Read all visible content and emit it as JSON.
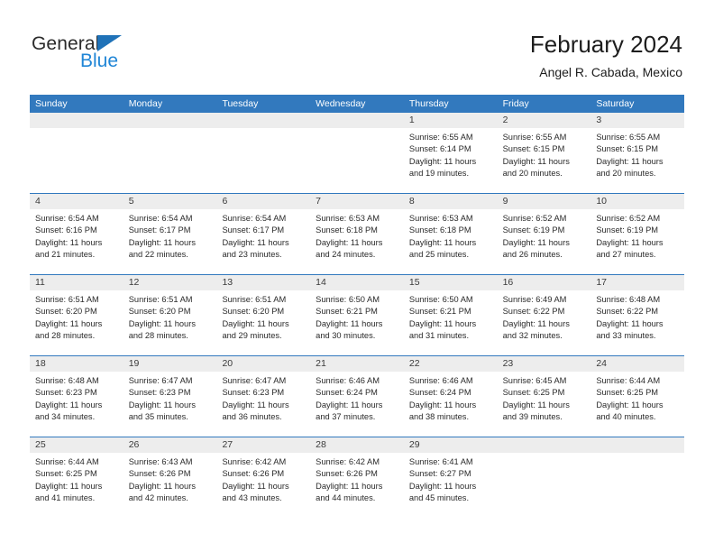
{
  "brand": {
    "name_part1": "General",
    "name_part2": "Blue",
    "triangle_icon": "blue-triangle-icon",
    "color_dark": "#2b2b2b",
    "color_blue": "#1f85d6"
  },
  "header": {
    "title": "February 2024",
    "subtitle": "Angel R. Cabada, Mexico"
  },
  "theme": {
    "header_blue": "#3279be",
    "daynum_gray": "#ededed",
    "text": "#2a2a2a"
  },
  "weekdays": [
    "Sunday",
    "Monday",
    "Tuesday",
    "Wednesday",
    "Thursday",
    "Friday",
    "Saturday"
  ],
  "weeks": [
    {
      "days": [
        {
          "num": "",
          "lines": []
        },
        {
          "num": "",
          "lines": []
        },
        {
          "num": "",
          "lines": []
        },
        {
          "num": "",
          "lines": []
        },
        {
          "num": "1",
          "lines": [
            "Sunrise: 6:55 AM",
            "Sunset: 6:14 PM",
            "Daylight: 11 hours",
            "and 19 minutes."
          ]
        },
        {
          "num": "2",
          "lines": [
            "Sunrise: 6:55 AM",
            "Sunset: 6:15 PM",
            "Daylight: 11 hours",
            "and 20 minutes."
          ]
        },
        {
          "num": "3",
          "lines": [
            "Sunrise: 6:55 AM",
            "Sunset: 6:15 PM",
            "Daylight: 11 hours",
            "and 20 minutes."
          ]
        }
      ]
    },
    {
      "days": [
        {
          "num": "4",
          "lines": [
            "Sunrise: 6:54 AM",
            "Sunset: 6:16 PM",
            "Daylight: 11 hours",
            "and 21 minutes."
          ]
        },
        {
          "num": "5",
          "lines": [
            "Sunrise: 6:54 AM",
            "Sunset: 6:17 PM",
            "Daylight: 11 hours",
            "and 22 minutes."
          ]
        },
        {
          "num": "6",
          "lines": [
            "Sunrise: 6:54 AM",
            "Sunset: 6:17 PM",
            "Daylight: 11 hours",
            "and 23 minutes."
          ]
        },
        {
          "num": "7",
          "lines": [
            "Sunrise: 6:53 AM",
            "Sunset: 6:18 PM",
            "Daylight: 11 hours",
            "and 24 minutes."
          ]
        },
        {
          "num": "8",
          "lines": [
            "Sunrise: 6:53 AM",
            "Sunset: 6:18 PM",
            "Daylight: 11 hours",
            "and 25 minutes."
          ]
        },
        {
          "num": "9",
          "lines": [
            "Sunrise: 6:52 AM",
            "Sunset: 6:19 PM",
            "Daylight: 11 hours",
            "and 26 minutes."
          ]
        },
        {
          "num": "10",
          "lines": [
            "Sunrise: 6:52 AM",
            "Sunset: 6:19 PM",
            "Daylight: 11 hours",
            "and 27 minutes."
          ]
        }
      ]
    },
    {
      "days": [
        {
          "num": "11",
          "lines": [
            "Sunrise: 6:51 AM",
            "Sunset: 6:20 PM",
            "Daylight: 11 hours",
            "and 28 minutes."
          ]
        },
        {
          "num": "12",
          "lines": [
            "Sunrise: 6:51 AM",
            "Sunset: 6:20 PM",
            "Daylight: 11 hours",
            "and 28 minutes."
          ]
        },
        {
          "num": "13",
          "lines": [
            "Sunrise: 6:51 AM",
            "Sunset: 6:20 PM",
            "Daylight: 11 hours",
            "and 29 minutes."
          ]
        },
        {
          "num": "14",
          "lines": [
            "Sunrise: 6:50 AM",
            "Sunset: 6:21 PM",
            "Daylight: 11 hours",
            "and 30 minutes."
          ]
        },
        {
          "num": "15",
          "lines": [
            "Sunrise: 6:50 AM",
            "Sunset: 6:21 PM",
            "Daylight: 11 hours",
            "and 31 minutes."
          ]
        },
        {
          "num": "16",
          "lines": [
            "Sunrise: 6:49 AM",
            "Sunset: 6:22 PM",
            "Daylight: 11 hours",
            "and 32 minutes."
          ]
        },
        {
          "num": "17",
          "lines": [
            "Sunrise: 6:48 AM",
            "Sunset: 6:22 PM",
            "Daylight: 11 hours",
            "and 33 minutes."
          ]
        }
      ]
    },
    {
      "days": [
        {
          "num": "18",
          "lines": [
            "Sunrise: 6:48 AM",
            "Sunset: 6:23 PM",
            "Daylight: 11 hours",
            "and 34 minutes."
          ]
        },
        {
          "num": "19",
          "lines": [
            "Sunrise: 6:47 AM",
            "Sunset: 6:23 PM",
            "Daylight: 11 hours",
            "and 35 minutes."
          ]
        },
        {
          "num": "20",
          "lines": [
            "Sunrise: 6:47 AM",
            "Sunset: 6:23 PM",
            "Daylight: 11 hours",
            "and 36 minutes."
          ]
        },
        {
          "num": "21",
          "lines": [
            "Sunrise: 6:46 AM",
            "Sunset: 6:24 PM",
            "Daylight: 11 hours",
            "and 37 minutes."
          ]
        },
        {
          "num": "22",
          "lines": [
            "Sunrise: 6:46 AM",
            "Sunset: 6:24 PM",
            "Daylight: 11 hours",
            "and 38 minutes."
          ]
        },
        {
          "num": "23",
          "lines": [
            "Sunrise: 6:45 AM",
            "Sunset: 6:25 PM",
            "Daylight: 11 hours",
            "and 39 minutes."
          ]
        },
        {
          "num": "24",
          "lines": [
            "Sunrise: 6:44 AM",
            "Sunset: 6:25 PM",
            "Daylight: 11 hours",
            "and 40 minutes."
          ]
        }
      ]
    },
    {
      "days": [
        {
          "num": "25",
          "lines": [
            "Sunrise: 6:44 AM",
            "Sunset: 6:25 PM",
            "Daylight: 11 hours",
            "and 41 minutes."
          ]
        },
        {
          "num": "26",
          "lines": [
            "Sunrise: 6:43 AM",
            "Sunset: 6:26 PM",
            "Daylight: 11 hours",
            "and 42 minutes."
          ]
        },
        {
          "num": "27",
          "lines": [
            "Sunrise: 6:42 AM",
            "Sunset: 6:26 PM",
            "Daylight: 11 hours",
            "and 43 minutes."
          ]
        },
        {
          "num": "28",
          "lines": [
            "Sunrise: 6:42 AM",
            "Sunset: 6:26 PM",
            "Daylight: 11 hours",
            "and 44 minutes."
          ]
        },
        {
          "num": "29",
          "lines": [
            "Sunrise: 6:41 AM",
            "Sunset: 6:27 PM",
            "Daylight: 11 hours",
            "and 45 minutes."
          ]
        },
        {
          "num": "",
          "lines": []
        },
        {
          "num": "",
          "lines": []
        }
      ]
    }
  ]
}
